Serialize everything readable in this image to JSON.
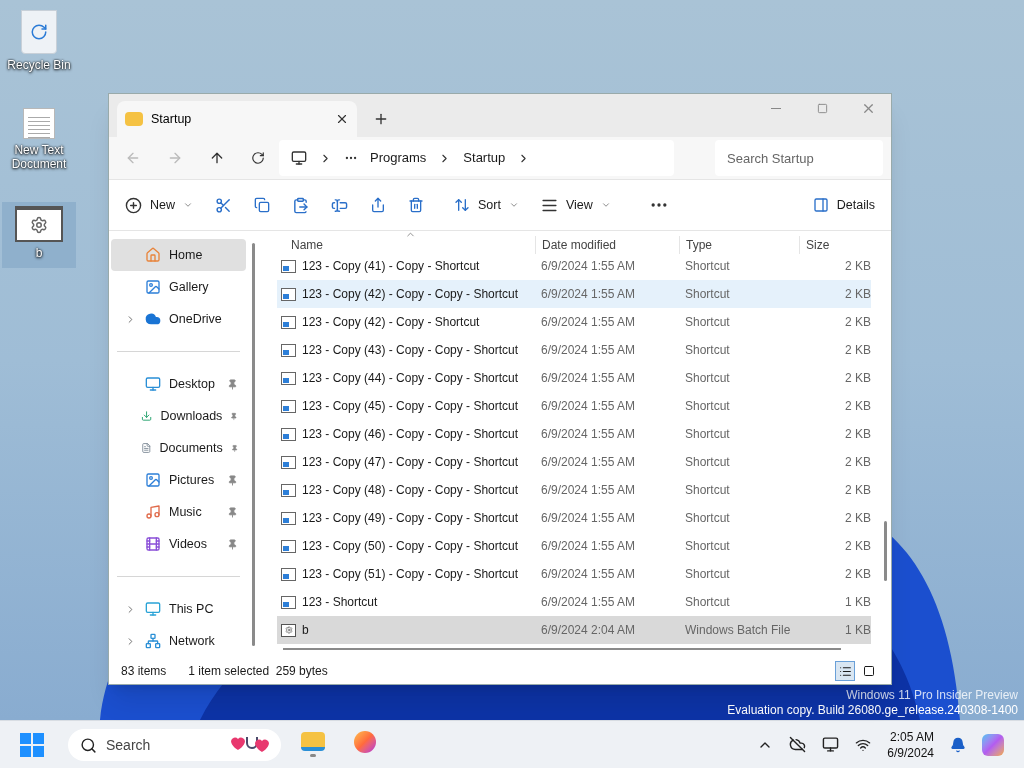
{
  "desktop_icons": [
    {
      "label": "Recycle Bin",
      "kind": "recycle",
      "selected": false
    },
    {
      "label": "New Text Document",
      "kind": "text",
      "selected": false
    },
    {
      "label": "b",
      "kind": "batch",
      "selected": true
    }
  ],
  "window": {
    "tab": {
      "title": "Startup"
    },
    "breadcrumb": [
      "Programs",
      "Startup"
    ],
    "search": {
      "placeholder": "Search Startup"
    },
    "toolbar": {
      "new": "New",
      "sort": "Sort",
      "view": "View",
      "details": "Details"
    },
    "sidebar": [
      {
        "items": [
          {
            "label": "Home",
            "kind": "home",
            "selected": true,
            "expandable": false,
            "pinned": false
          },
          {
            "label": "Gallery",
            "kind": "gallery",
            "selected": false,
            "expandable": false,
            "pinned": false
          },
          {
            "label": "OneDrive",
            "kind": "cloud",
            "selected": false,
            "expandable": true,
            "pinned": false
          }
        ]
      },
      {
        "items": [
          {
            "label": "Desktop",
            "kind": "desktop",
            "selected": false,
            "expandable": false,
            "pinned": true
          },
          {
            "label": "Downloads",
            "kind": "downloads",
            "selected": false,
            "expandable": false,
            "pinned": true
          },
          {
            "label": "Documents",
            "kind": "documents",
            "selected": false,
            "expandable": false,
            "pinned": true
          },
          {
            "label": "Pictures",
            "kind": "pictures",
            "selected": false,
            "expandable": false,
            "pinned": true
          },
          {
            "label": "Music",
            "kind": "music",
            "selected": false,
            "expandable": false,
            "pinned": true
          },
          {
            "label": "Videos",
            "kind": "videos",
            "selected": false,
            "expandable": false,
            "pinned": true
          }
        ]
      },
      {
        "items": [
          {
            "label": "This PC",
            "kind": "pc",
            "selected": false,
            "expandable": true,
            "pinned": false
          },
          {
            "label": "Network",
            "kind": "network",
            "selected": false,
            "expandable": true,
            "pinned": false
          }
        ]
      }
    ],
    "columns": [
      "Name",
      "Date modified",
      "Type",
      "Size"
    ],
    "rows": [
      {
        "name": "123 - Copy (41) - Copy - Shortcut",
        "date": "6/9/2024 1:55 AM",
        "type": "Shortcut",
        "size": "2 KB",
        "kind": "shortcut",
        "selected": false,
        "hovered": false
      },
      {
        "name": "123 - Copy (42) - Copy - Copy - Shortcut",
        "date": "6/9/2024 1:55 AM",
        "type": "Shortcut",
        "size": "2 KB",
        "kind": "shortcut",
        "selected": false,
        "hovered": true
      },
      {
        "name": "123 - Copy (42) - Copy - Shortcut",
        "date": "6/9/2024 1:55 AM",
        "type": "Shortcut",
        "size": "2 KB",
        "kind": "shortcut",
        "selected": false,
        "hovered": false
      },
      {
        "name": "123 - Copy (43) - Copy - Copy - Shortcut",
        "date": "6/9/2024 1:55 AM",
        "type": "Shortcut",
        "size": "2 KB",
        "kind": "shortcut",
        "selected": false,
        "hovered": false
      },
      {
        "name": "123 - Copy (44) - Copy - Copy - Shortcut",
        "date": "6/9/2024 1:55 AM",
        "type": "Shortcut",
        "size": "2 KB",
        "kind": "shortcut",
        "selected": false,
        "hovered": false
      },
      {
        "name": "123 - Copy (45) - Copy - Copy - Shortcut",
        "date": "6/9/2024 1:55 AM",
        "type": "Shortcut",
        "size": "2 KB",
        "kind": "shortcut",
        "selected": false,
        "hovered": false
      },
      {
        "name": "123 - Copy (46) - Copy - Copy - Shortcut",
        "date": "6/9/2024 1:55 AM",
        "type": "Shortcut",
        "size": "2 KB",
        "kind": "shortcut",
        "selected": false,
        "hovered": false
      },
      {
        "name": "123 - Copy (47) - Copy - Copy - Shortcut",
        "date": "6/9/2024 1:55 AM",
        "type": "Shortcut",
        "size": "2 KB",
        "kind": "shortcut",
        "selected": false,
        "hovered": false
      },
      {
        "name": "123 - Copy (48) - Copy - Copy - Shortcut",
        "date": "6/9/2024 1:55 AM",
        "type": "Shortcut",
        "size": "2 KB",
        "kind": "shortcut",
        "selected": false,
        "hovered": false
      },
      {
        "name": "123 - Copy (49) - Copy - Copy - Shortcut",
        "date": "6/9/2024 1:55 AM",
        "type": "Shortcut",
        "size": "2 KB",
        "kind": "shortcut",
        "selected": false,
        "hovered": false
      },
      {
        "name": "123 - Copy (50) - Copy - Copy - Shortcut",
        "date": "6/9/2024 1:55 AM",
        "type": "Shortcut",
        "size": "2 KB",
        "kind": "shortcut",
        "selected": false,
        "hovered": false
      },
      {
        "name": "123 - Copy (51) - Copy - Copy - Shortcut",
        "date": "6/9/2024 1:55 AM",
        "type": "Shortcut",
        "size": "2 KB",
        "kind": "shortcut",
        "selected": false,
        "hovered": false
      },
      {
        "name": "123 - Shortcut",
        "date": "6/9/2024 1:55 AM",
        "type": "Shortcut",
        "size": "1 KB",
        "kind": "shortcut",
        "selected": false,
        "hovered": false
      },
      {
        "name": "b",
        "date": "6/9/2024 2:04 AM",
        "type": "Windows Batch File",
        "size": "1 KB",
        "kind": "batch",
        "selected": true,
        "hovered": false
      }
    ],
    "status_bar": {
      "count": "83 items",
      "selection": "1 item selected  259 bytes"
    }
  },
  "watermark_notice": [
    "Windows 11 Pro Insider Preview",
    "Evaluation copy. Build 26080.ge_release.240308-1400"
  ],
  "taskbar": {
    "search": {
      "placeholder": "Search"
    },
    "apps": [
      {
        "kind": "explorer",
        "selected": true
      },
      {
        "kind": "firefox",
        "selected": false
      }
    ],
    "time": "2:05 AM",
    "date": "6/9/2024"
  }
}
